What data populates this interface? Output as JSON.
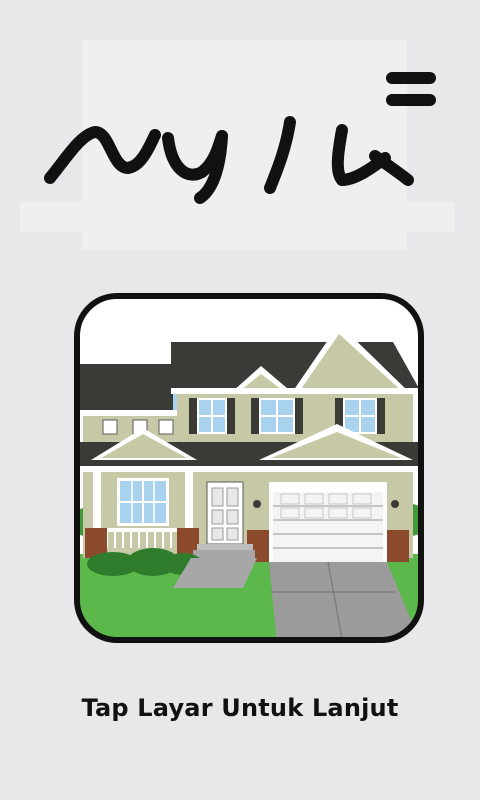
{
  "screen": {
    "prompt": "Tap Layar Untuk Lanjut",
    "logo_icon": "handwritten-logo-icon",
    "app_icon": "house-icon"
  },
  "colors": {
    "background": "#e8e8ea",
    "logo_backdrop": "#efefef",
    "logo_stroke": "#111111",
    "tile_border": "#111111",
    "sky": "#a9d2ef",
    "roof": "#3a3a36",
    "siding": "#c7c9a6",
    "trim": "#ffffff",
    "grass": "#5cb84a",
    "driveway": "#9b9b9b",
    "brick": "#8b4a2b"
  }
}
